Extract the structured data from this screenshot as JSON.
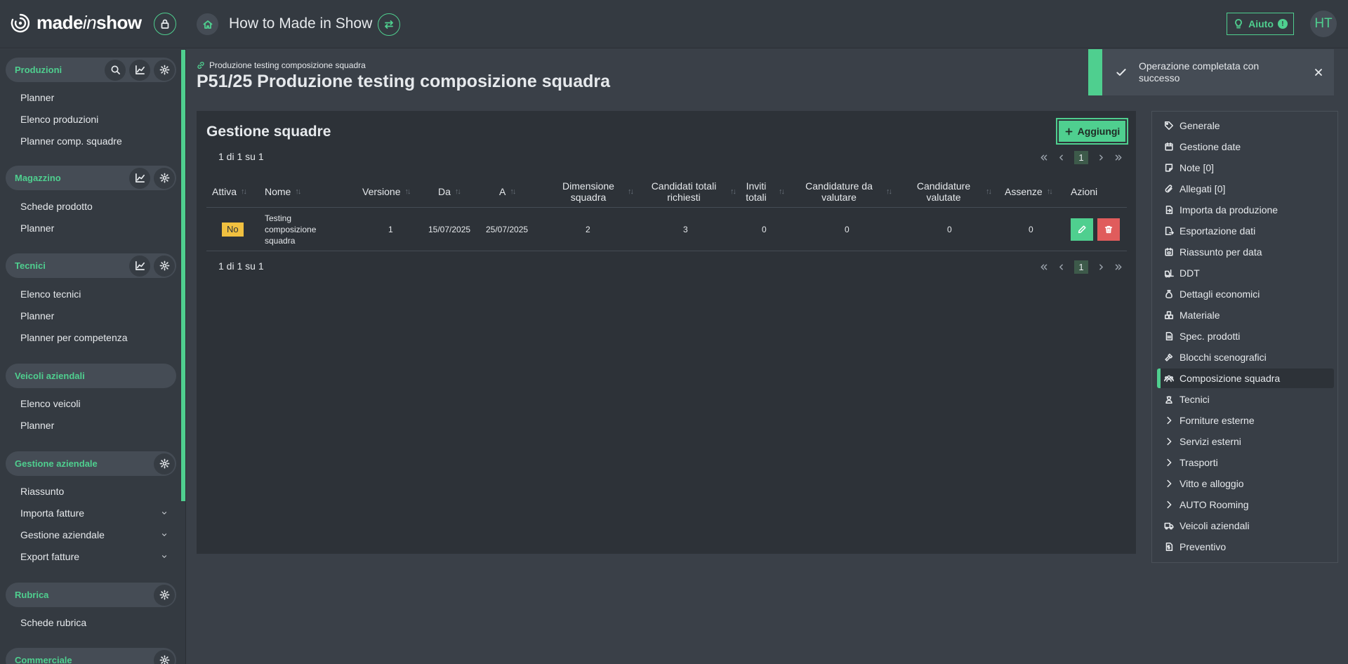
{
  "header": {
    "logo_text_a": "made",
    "logo_text_b": "in",
    "logo_text_c": "show",
    "app_title": "How to Made in Show",
    "help_label": "Aiuto",
    "help_badge": "!",
    "avatar_initials": "HT"
  },
  "sidebar": {
    "sections": [
      {
        "title": "Produzioni",
        "items": [
          "Planner",
          "Elenco produzioni",
          "Planner comp. squadre"
        ]
      },
      {
        "title": "Magazzino",
        "items": [
          "Schede prodotto",
          "Planner"
        ]
      },
      {
        "title": "Tecnici",
        "items": [
          "Elenco tecnici",
          "Planner",
          "Planner per competenza"
        ]
      },
      {
        "title": "Veicoli aziendali",
        "items": [
          "Elenco veicoli",
          "Planner"
        ]
      },
      {
        "title": "Gestione aziendale",
        "items": [
          "Riassunto",
          "Importa fatture",
          "Gestione aziendale",
          "Export fatture"
        ]
      },
      {
        "title": "Rubrica",
        "items": [
          "Schede rubrica"
        ]
      },
      {
        "title": "Commerciale",
        "items": []
      }
    ]
  },
  "main": {
    "breadcrumb": "Produzione testing composizione squadra",
    "title": "P51/25 Produzione testing composizione squadra"
  },
  "toast": {
    "message": "Operazione completata con successo"
  },
  "card": {
    "title": "Gestione squadre",
    "add_label": "Aggiungi",
    "count_top": "1 di 1 su 1",
    "count_bottom": "1 di 1 su 1",
    "page": "1",
    "columns": [
      "Attiva",
      "Nome",
      "Versione",
      "Da",
      "A",
      "Dimensione squadra",
      "Candidati totali richiesti",
      "Inviti totali",
      "Candidature da valutare",
      "Candidature valutate",
      "Assenze",
      "Azioni"
    ],
    "rows": [
      {
        "attiva": "No",
        "nome": "Testing composizione squadra",
        "versione": "1",
        "da": "15/07/2025",
        "a": "25/07/2025",
        "dimensione": "2",
        "candidati": "3",
        "inviti": "0",
        "da_valutare": "0",
        "valutate": "0",
        "assenze": "0"
      }
    ]
  },
  "side_menu": {
    "items": [
      "Generale",
      "Gestione date",
      "Note [0]",
      "Allegati [0]",
      "Importa da produzione",
      "Esportazione dati",
      "Riassunto per data",
      "DDT",
      "Dettagli economici",
      "Materiale",
      "Spec. prodotti",
      "Blocchi scenografici",
      "Composizione squadra",
      "Tecnici",
      "Forniture esterne",
      "Servizi esterni",
      "Trasporti",
      "Vitto e alloggio",
      "AUTO Rooming",
      "Veicoli aziendali",
      "Preventivo"
    ],
    "active": "Composizione squadra"
  },
  "colors": {
    "accent": "#4fcf8f",
    "background": "#3a4048",
    "panel": "#343a41",
    "badge_warning": "#f0c040",
    "danger": "#e05c5c"
  }
}
